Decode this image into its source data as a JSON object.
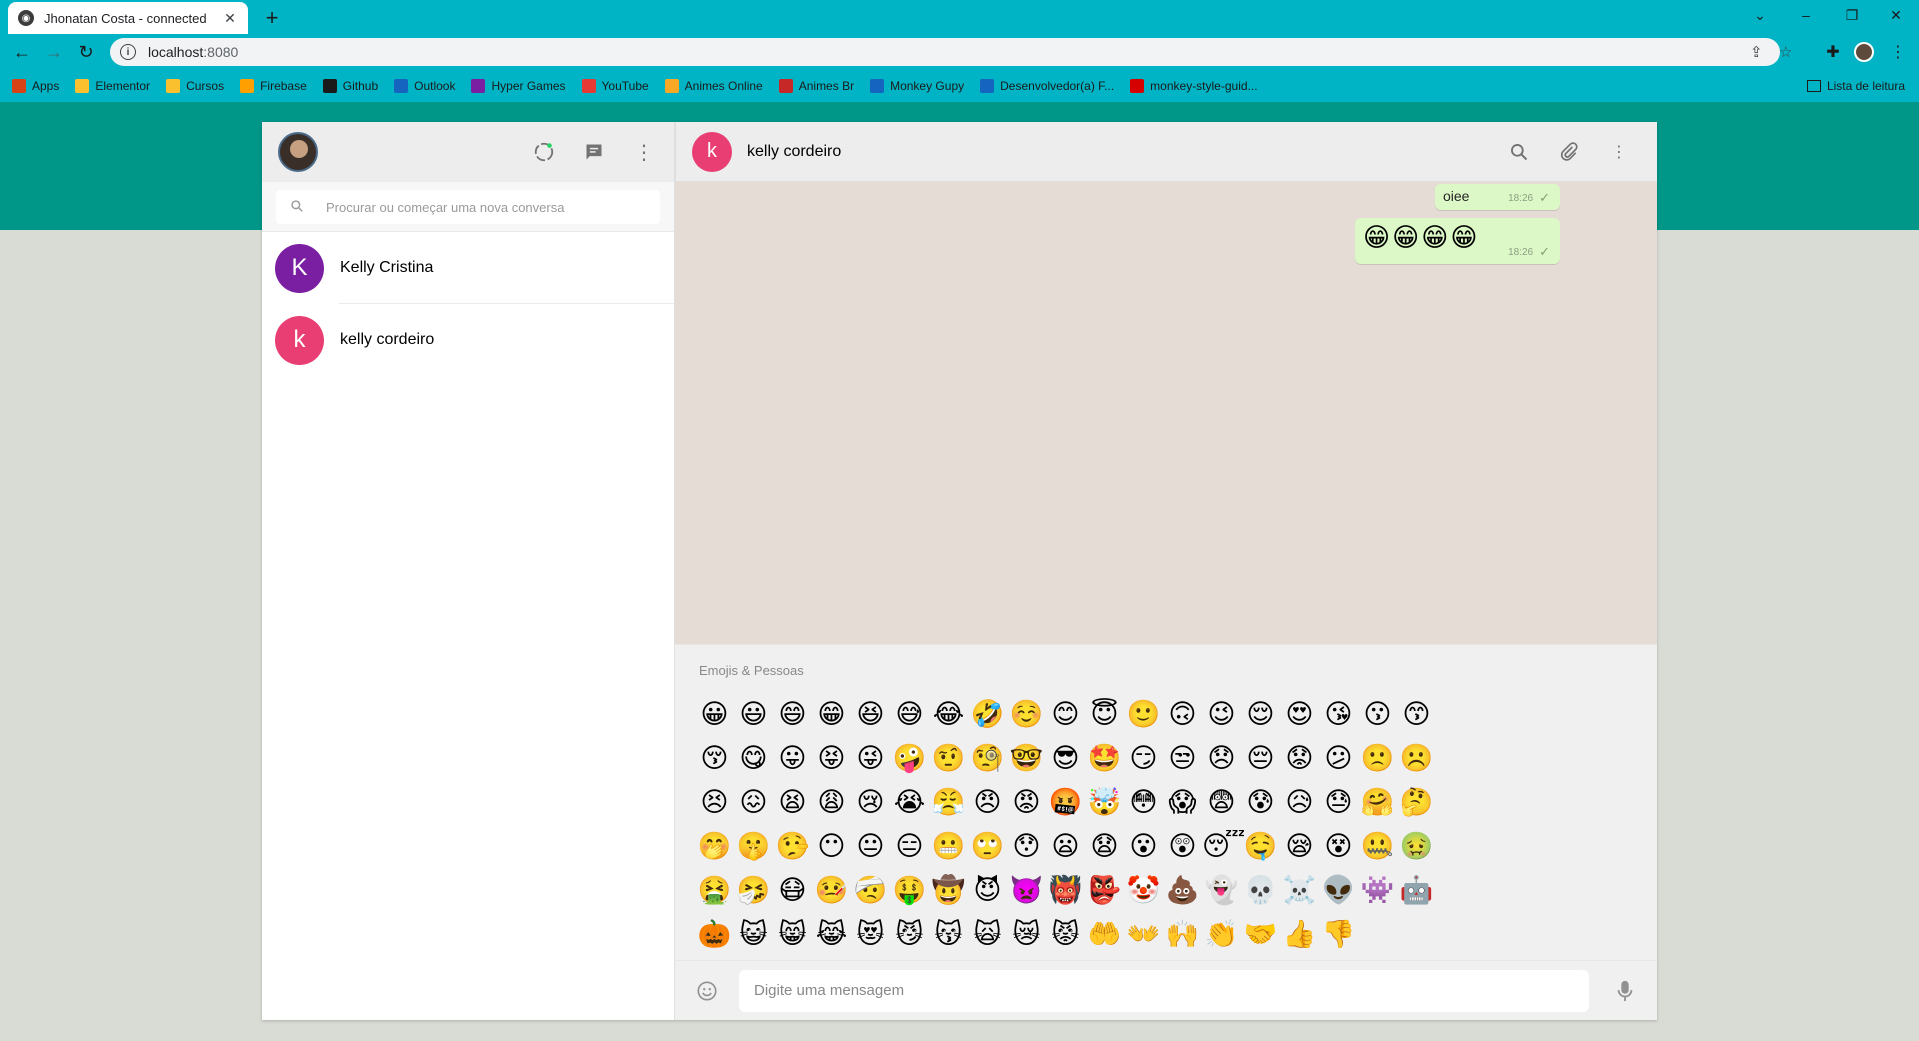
{
  "browser": {
    "tab_title": "Jhonatan Costa - connected",
    "tab_close": "✕",
    "new_tab": "+",
    "url_host": "localhost",
    "url_port": ":8080",
    "bookmarks": [
      {
        "label": "Apps",
        "color": "#d84315"
      },
      {
        "label": "Elementor",
        "color": "#fbc02d"
      },
      {
        "label": "Cursos",
        "color": "#fbc02d"
      },
      {
        "label": "Firebase",
        "color": "#ffa000"
      },
      {
        "label": "Github",
        "color": "#1a1a1a"
      },
      {
        "label": "Outlook",
        "color": "#1565c0"
      },
      {
        "label": "Hyper Games",
        "color": "#7b1fa2"
      },
      {
        "label": "YouTube",
        "color": "#e53935"
      },
      {
        "label": "Animes Online",
        "color": "#f9a825"
      },
      {
        "label": "Animes Br",
        "color": "#c62828"
      },
      {
        "label": "Monkey Gupy",
        "color": "#1565c0"
      },
      {
        "label": "Desenvolvedor(a) F...",
        "color": "#1565c0"
      },
      {
        "label": "monkey-style-guid...",
        "color": "#d50000"
      }
    ],
    "reading_list": "Lista de leitura"
  },
  "sidebar": {
    "search_placeholder": "Procurar ou começar uma nova conversa",
    "contacts": [
      {
        "initial": "K",
        "name": "Kelly Cristina",
        "color": "#7b1fa2"
      },
      {
        "initial": "k",
        "name": "kelly cordeiro",
        "color": "#e83e74"
      }
    ]
  },
  "chat": {
    "contact_initial": "k",
    "contact_name": "kelly cordeiro",
    "messages": [
      {
        "text": "oiee",
        "time": "18:26",
        "tick": "✓"
      },
      {
        "text": "😁😁😁😁",
        "time": "18:26",
        "tick": "✓"
      }
    ]
  },
  "emoji_panel": {
    "category": "Emojis & Pessoas",
    "emojis": [
      "😀",
      "😃",
      "😄",
      "😁",
      "😆",
      "😅",
      "😂",
      "🤣",
      "☺️",
      "😊",
      "😇",
      "🙂",
      "🙃",
      "😉",
      "😌",
      "😍",
      "😘",
      "😗",
      "😙",
      "😚",
      "😋",
      "😛",
      "😝",
      "😜",
      "🤪",
      "🤨",
      "🧐",
      "🤓",
      "😎",
      "🤩",
      "😏",
      "😒",
      "😞",
      "😔",
      "😟",
      "😕",
      "🙁",
      "☹️",
      "😣",
      "😖",
      "😫",
      "😩",
      "😢",
      "😭",
      "😤",
      "😠",
      "😡",
      "🤬",
      "🤯",
      "😳",
      "😱",
      "😨",
      "😰",
      "😥",
      "😓",
      "🤗",
      "🤔",
      "🤭",
      "🤫",
      "🤥",
      "😶",
      "😐",
      "😑",
      "😬",
      "🙄",
      "😯",
      "😦",
      "😧",
      "😮",
      "😲",
      "😴",
      "🤤",
      "😪",
      "😵",
      "🤐",
      "🤢",
      "🤮",
      "🤧",
      "😷",
      "🤒",
      "🤕",
      "🤑",
      "🤠",
      "😈",
      "👿",
      "👹",
      "👺",
      "🤡",
      "💩",
      "👻",
      "💀",
      "☠️",
      "👽",
      "👾",
      "🤖",
      "🎃",
      "😺",
      "😸",
      "😹",
      "😻",
      "😼",
      "😽",
      "🙀",
      "😿",
      "😾",
      "🤲",
      "👐",
      "🙌",
      "👏",
      "🤝",
      "👍",
      "👎"
    ]
  },
  "composer": {
    "placeholder": "Digite uma mensagem"
  }
}
